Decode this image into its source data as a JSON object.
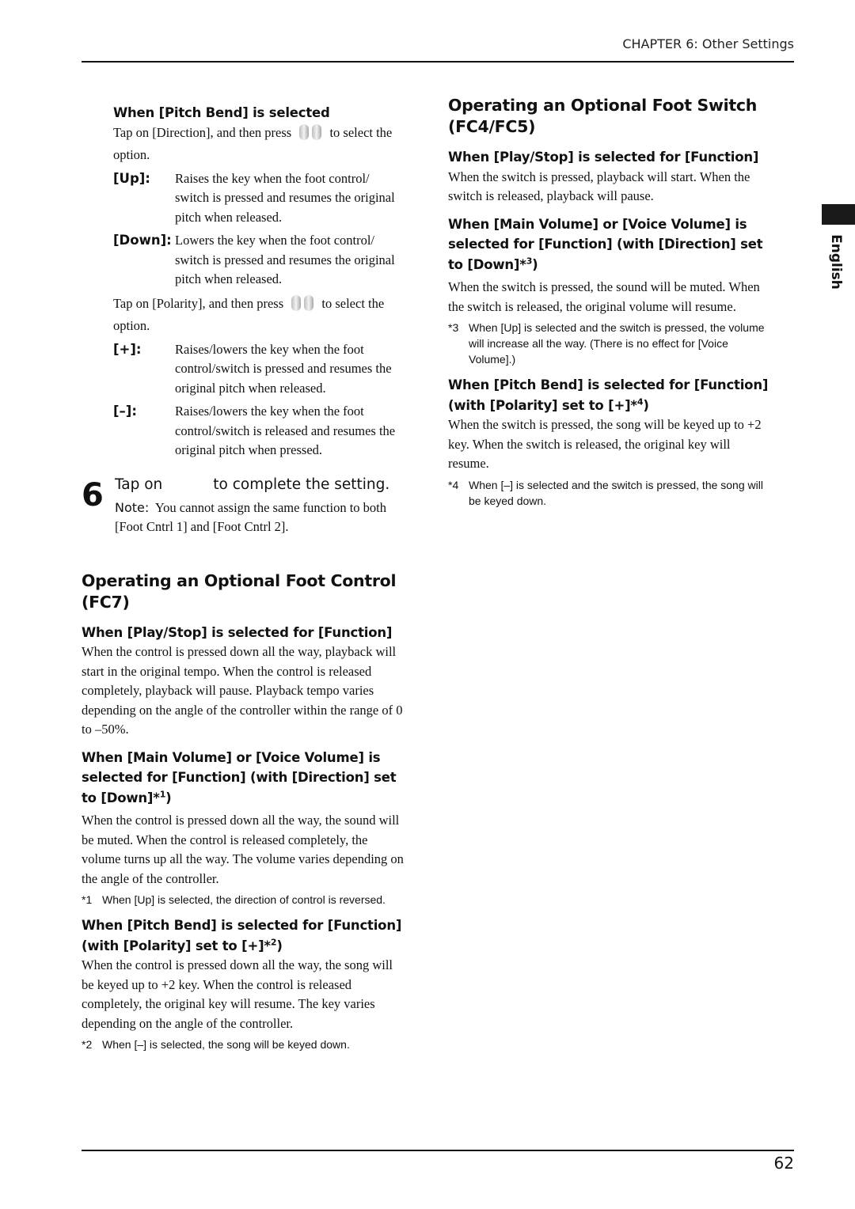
{
  "header": {
    "chapter": "CHAPTER 6: Other Settings"
  },
  "side_tab": {
    "label": "English"
  },
  "footer": {
    "page_number": "62"
  },
  "left": {
    "pitch_bend": {
      "heading": "When [Pitch Bend] is selected",
      "direction_pre": "Tap on [Direction], and then press",
      "direction_post": "to select the option.",
      "up_term": "[Up]:",
      "up_desc": "Raises the key when the foot control/ switch is pressed and resumes the original pitch when released.",
      "down_term": "[Down]:",
      "down_desc": "Lowers the key when the foot control/ switch is pressed and resumes the original pitch when released.",
      "polarity_pre": "Tap on [Polarity], and then press",
      "polarity_post": "to select the option.",
      "plus_term": "[+]:",
      "plus_desc": "Raises/lowers the key when the foot control/switch is pressed and resumes the original pitch when released.",
      "minus_term": "[–]:",
      "minus_desc": "Raises/lowers the key when the foot control/switch is released and resumes the original pitch when pressed."
    },
    "step6": {
      "number": "6",
      "text_pre": "Tap on",
      "text_post": "to complete the setting.",
      "note_label": "Note:",
      "note_text": "You cannot assign the same function to both [Foot Cntrl 1] and [Foot Cntrl 2]."
    },
    "fc7": {
      "title": "Operating an Optional Foot Control (FC7)",
      "playstop_heading": "When [Play/Stop] is selected for [Function]",
      "playstop_text": "When the control is pressed down all the way, playback will start in the original tempo. When the control is released completely, playback will pause. Playback tempo varies depending on the angle of the controller within the range of 0 to –50%.",
      "volume_heading": "When [Main Volume] or [Voice Volume] is selected for [Function] (with [Direction] set to [Down]*",
      "volume_sup": "1",
      "volume_text": "When the control is pressed down all the way, the sound will be muted. When the control is released completely, the volume turns up all the way. The volume varies depending on the angle of the controller.",
      "fn1_mark": "*1",
      "fn1_text": "When [Up] is selected, the direction of control is reversed.",
      "pitch_heading": "When [Pitch Bend] is selected for [Function] (with [Polarity] set to [+]*",
      "pitch_sup": "2",
      "pitch_text": "When the control is pressed down all the way, the song will be keyed up to +2 key. When the control is released completely, the original key will resume. The key varies depending on the angle of the controller.",
      "fn2_mark": "*2",
      "fn2_text": "When [–] is selected, the song will be keyed down."
    }
  },
  "right": {
    "title": "Operating an Optional Foot Switch (FC4/FC5)",
    "playstop_heading": "When [Play/Stop] is selected for [Function]",
    "playstop_text": "When the switch is pressed, playback will start. When the switch is released, playback will pause.",
    "volume_heading": "When [Main Volume] or [Voice Volume] is selected for [Function] (with [Direction] set to [Down]*",
    "volume_sup": "3",
    "volume_text": "When the switch is pressed, the sound will be muted. When the switch is released, the original volume will resume.",
    "fn3_mark": "*3",
    "fn3_text": "When [Up] is selected and the switch is pressed, the volume will increase all the way. (There is no effect for [Voice Volume].)",
    "pitch_heading": "When [Pitch Bend] is selected for [Function] (with [Polarity] set to [+]*",
    "pitch_sup": "4",
    "pitch_text": "When the switch is pressed, the song will be keyed up to +2 key. When the switch is released, the original key will resume.",
    "fn4_mark": "*4",
    "fn4_text": "When [–] is selected and the switch is pressed, the song will be keyed down."
  }
}
